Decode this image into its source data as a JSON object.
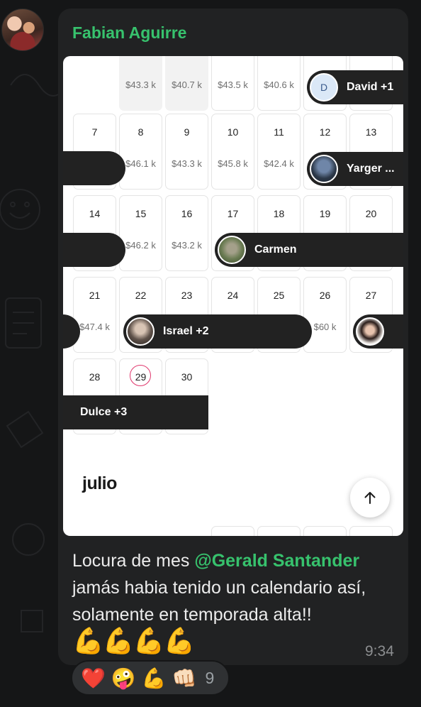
{
  "message": {
    "sender": "Fabian Aguirre",
    "text_before": "Locura de mes ",
    "mention": "@Gerald Santander",
    "text_after": " jamás habia tenido un calendario así, solamente en temporada alta!!",
    "emojis": "💪💪💪💪",
    "time": "9:34"
  },
  "calendar": {
    "top_prices": [
      "$43.3 k",
      "$40.7 k",
      "$43.5 k",
      "$40.6 k"
    ],
    "week2": {
      "days": [
        "7",
        "8",
        "9",
        "10",
        "11",
        "12",
        "13"
      ],
      "prices": [
        "",
        "$46.1 k",
        "$43.3 k",
        "$45.8 k",
        "$42.4 k",
        "",
        ""
      ]
    },
    "week3": {
      "days": [
        "14",
        "15",
        "16",
        "17",
        "18",
        "19",
        "20"
      ],
      "prices": [
        "",
        "$46.2 k",
        "$43.2 k",
        "",
        "",
        "",
        ""
      ]
    },
    "week4": {
      "days": [
        "21",
        "22",
        "23",
        "24",
        "25",
        "26",
        "27"
      ],
      "prices": [
        "$47.4 k",
        "",
        "",
        "",
        "",
        "$60 k",
        ""
      ]
    },
    "week5": {
      "days": [
        "28",
        "29",
        "30"
      ]
    },
    "reservations": {
      "david": "David +1",
      "david_initial": "D",
      "yarger": "Yarger ...",
      "carmen": "Carmen",
      "israel": "Israel +2",
      "dulce": "Dulce +3"
    },
    "next_month": "julio"
  },
  "reactions": {
    "emojis": [
      "❤️",
      "🤪",
      "💪",
      "👊🏻"
    ],
    "count": "9"
  },
  "colors": {
    "accent": "#37c26d",
    "today_ring": "#e0386d",
    "bar": "#222222"
  }
}
